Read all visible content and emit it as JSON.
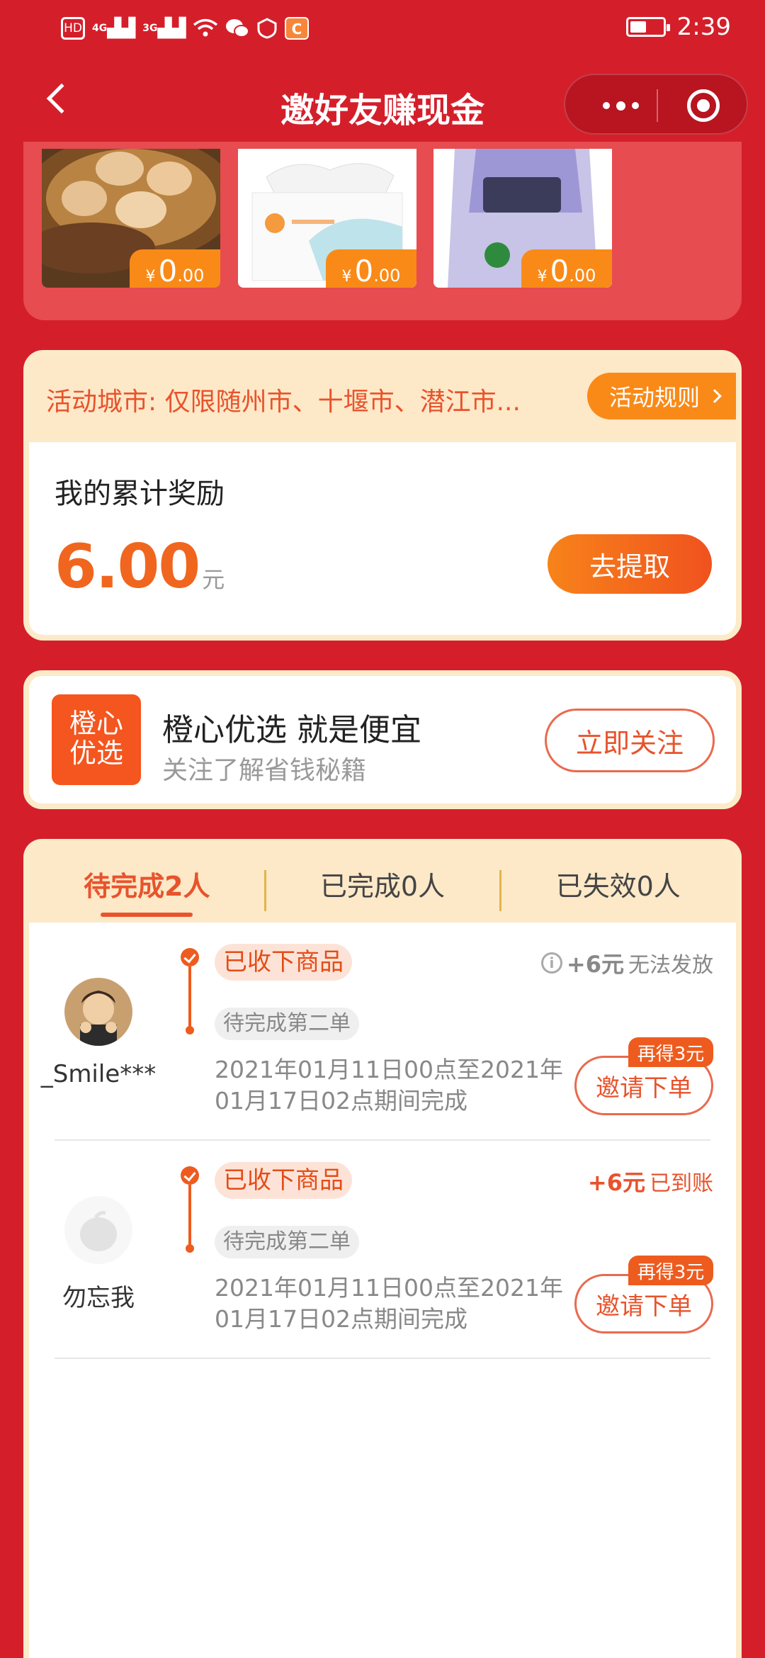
{
  "status_bar": {
    "left_icons": [
      "hd-icon",
      "4g-signal-icon",
      "3g-signal-icon",
      "wifi-icon",
      "wechat-icon",
      "shield-icon",
      "app-icon"
    ],
    "labels": {
      "hd": "HD",
      "g4": "4G",
      "g3": "3G"
    },
    "time": "2:39",
    "battery_level": 0.45
  },
  "nav": {
    "title": "邀好友赚现金"
  },
  "products": [
    {
      "name": "eggs",
      "price_symbol": "¥",
      "price_int": "0",
      "price_dec": ".00"
    },
    {
      "name": "tissue",
      "price_symbol": "¥",
      "price_int": "0",
      "price_dec": ".00"
    },
    {
      "name": "salt",
      "price_symbol": "¥",
      "price_int": "0",
      "price_dec": ".00"
    }
  ],
  "reward": {
    "city_text": "活动城市: 仅限随州市、十堰市、潜江市...",
    "rules_label": "活动规则",
    "label": "我的累计奖励",
    "amount": "6.00",
    "unit": "元",
    "withdraw_label": "去提取"
  },
  "follow": {
    "logo_line1": "橙心",
    "logo_line2": "优选",
    "title": "橙心优选 就是便宜",
    "subtitle": "关注了解省钱秘籍",
    "button": "立即关注"
  },
  "tabs": [
    {
      "label": "待完成2人",
      "active": true
    },
    {
      "label": "已完成0人",
      "active": false
    },
    {
      "label": "已失效0人",
      "active": false
    }
  ],
  "invites": [
    {
      "name": "_Smile***",
      "tag_received": "已收下商品",
      "tag_pending": "待完成第二单",
      "period": "2021年01月11日00点至2021年01月17日02点期间完成",
      "bonus": "+6元",
      "bonus_note": "无法发放",
      "bonus_color": "#888888",
      "show_info_icon": true,
      "extra_badge": "再得3元",
      "button": "邀请下单"
    },
    {
      "name": "勿忘我",
      "tag_received": "已收下商品",
      "tag_pending": "待完成第二单",
      "period": "2021年01月11日00点至2021年01月17日02点期间完成",
      "bonus": "+6元",
      "bonus_note": "已到账",
      "bonus_color": "#e8532c",
      "show_info_icon": false,
      "extra_badge": "再得3元",
      "button": "邀请下单"
    }
  ],
  "colors": {
    "background_red": "#d41f2b",
    "accent_orange": "#f0661e",
    "cream": "#fde8c8"
  }
}
